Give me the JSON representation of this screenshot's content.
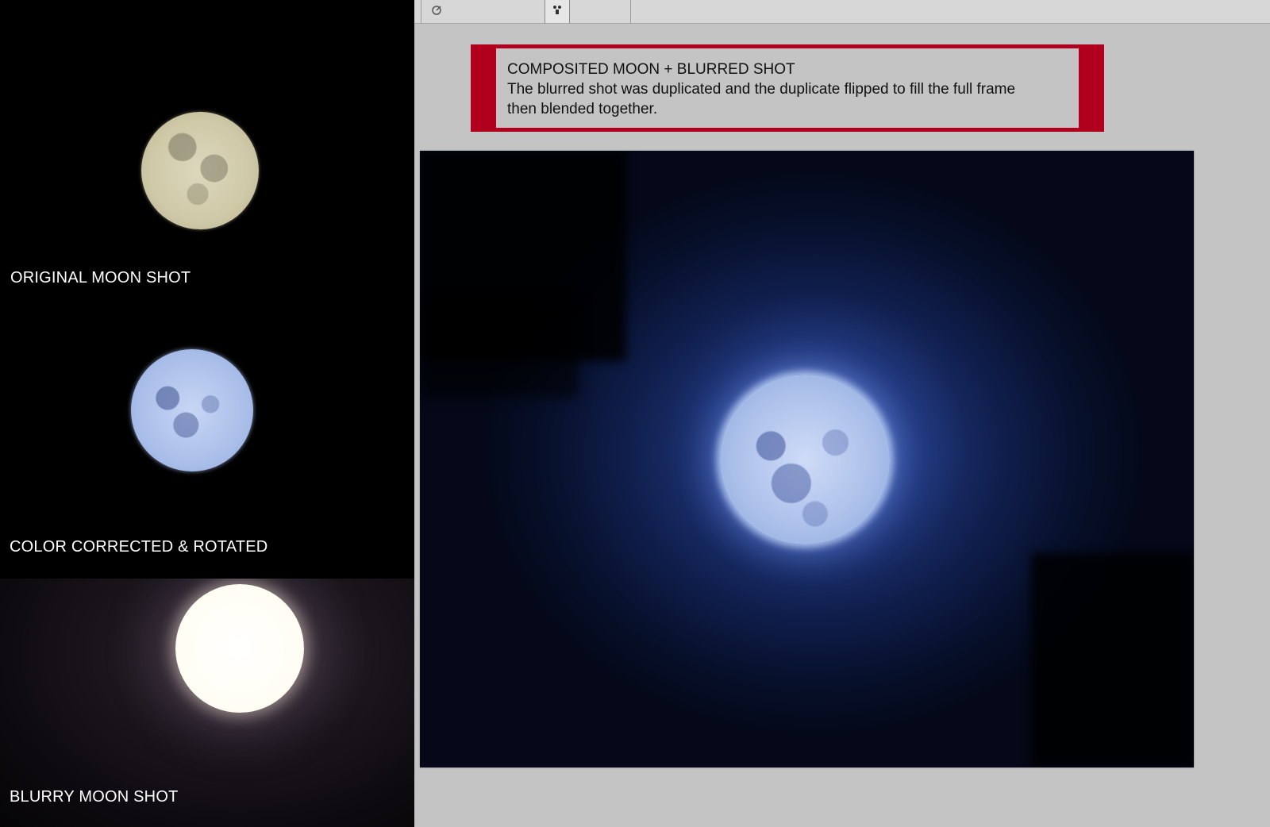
{
  "left_panel": {
    "captions": {
      "original": "ORIGINAL MOON SHOT",
      "corrected": "COLOR CORRECTED & ROTATED",
      "blurry": "BLURRY MOON SHOT"
    }
  },
  "annotation": {
    "title": "COMPOSITED MOON + BLURRED SHOT",
    "line1": "The blurred shot was duplicated and the duplicate flipped to fill the full frame",
    "line2": "then blended together."
  },
  "toolbar": {
    "icons": [
      "brush-settings-icon",
      "puppet-warp-icon"
    ]
  },
  "colors": {
    "annotation_border": "#b0001e",
    "canvas_bg": "#c4c4c4"
  }
}
